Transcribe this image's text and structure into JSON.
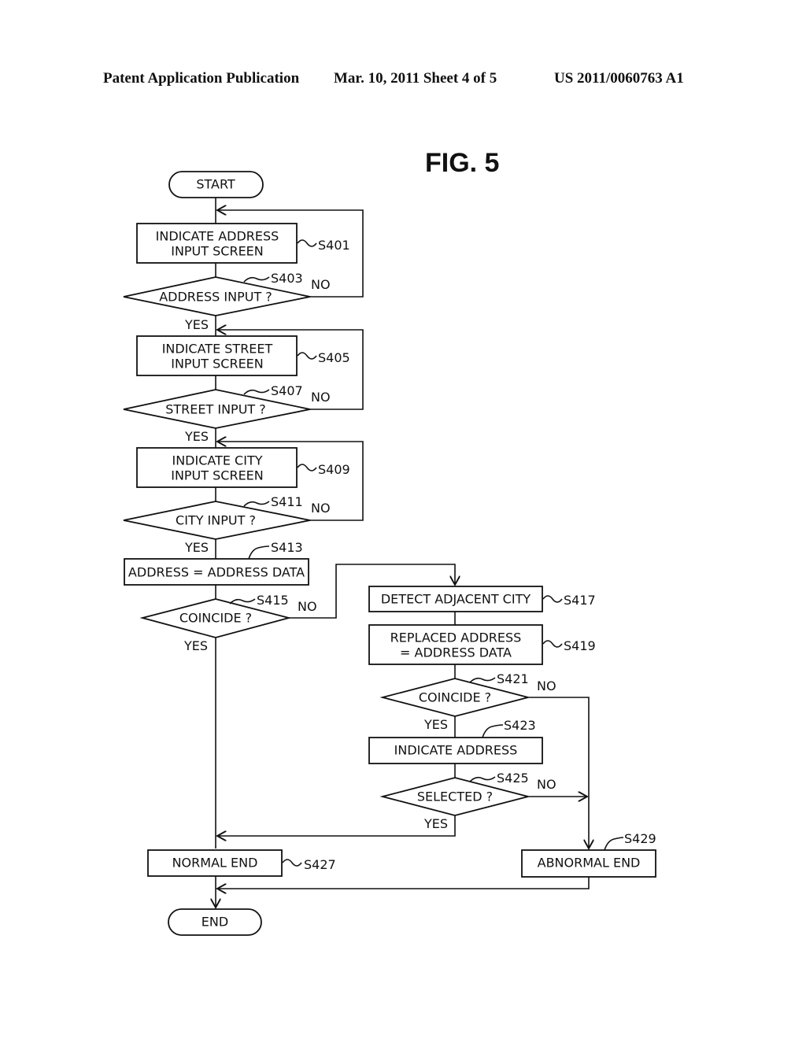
{
  "header": {
    "publication": "Patent Application Publication",
    "date_sheet": "Mar. 10, 2011  Sheet 4 of 5",
    "patent_number": "US 2011/0060763 A1"
  },
  "figure": {
    "title": "FIG. 5",
    "nodes": {
      "start": {
        "text": "START"
      },
      "s401": {
        "lines": [
          "INDICATE ADDRESS",
          "INPUT SCREEN"
        ],
        "ref": "S401"
      },
      "s403": {
        "text": "ADDRESS INPUT ?",
        "ref": "S403"
      },
      "s405": {
        "lines": [
          "INDICATE STREET",
          "INPUT SCREEN"
        ],
        "ref": "S405"
      },
      "s407": {
        "text": "STREET INPUT ?",
        "ref": "S407"
      },
      "s409": {
        "lines": [
          "INDICATE CITY",
          "INPUT SCREEN"
        ],
        "ref": "S409"
      },
      "s411": {
        "text": "CITY INPUT ?",
        "ref": "S411"
      },
      "s413": {
        "text": "ADDRESS = ADDRESS DATA",
        "ref": "S413"
      },
      "s415": {
        "text": "COINCIDE ?",
        "ref": "S415"
      },
      "s417": {
        "text": "DETECT ADJACENT CITY",
        "ref": "S417"
      },
      "s419": {
        "lines": [
          "REPLACED ADDRESS",
          "= ADDRESS DATA"
        ],
        "ref": "S419"
      },
      "s421": {
        "text": "COINCIDE ?",
        "ref": "S421"
      },
      "s423": {
        "text": "INDICATE ADDRESS",
        "ref": "S423"
      },
      "s425": {
        "text": "SELECTED ?",
        "ref": "S425"
      },
      "s427": {
        "text": "NORMAL END",
        "ref": "S427"
      },
      "s429": {
        "text": "ABNORMAL END",
        "ref": "S429"
      },
      "end": {
        "text": "END"
      }
    },
    "labels": {
      "yes": "YES",
      "no": "NO"
    }
  }
}
